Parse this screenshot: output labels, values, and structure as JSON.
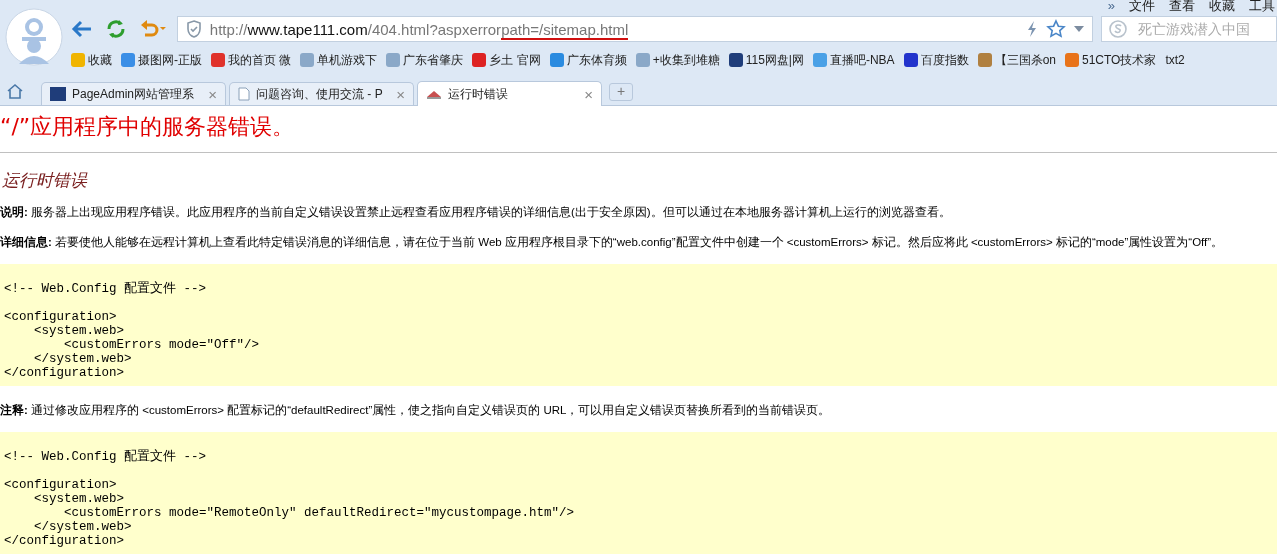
{
  "menu": {
    "chevron": "»",
    "items": [
      "文件",
      "查看",
      "收藏",
      "工具"
    ]
  },
  "address": {
    "segments": [
      {
        "text": "http://",
        "strong": false,
        "underlined": false
      },
      {
        "text": "www.tape111.com",
        "strong": true,
        "underlined": false
      },
      {
        "text": "/404.html?aspxerror",
        "strong": false,
        "underlined": false
      },
      {
        "text": "path=/sitemap.html",
        "strong": false,
        "underlined": true
      }
    ]
  },
  "search": {
    "placeholder": "死亡游戏潜入中国"
  },
  "bookmarks": [
    "收藏",
    "摄图网-正版",
    "我的首页 微",
    "单机游戏下",
    "广东省肇庆",
    "乡土 官网",
    "广东体育频",
    "+收集到堆糖",
    "115网盘|网",
    "直播吧-NBA",
    "百度指数",
    "【三国杀on",
    "51CTO技术家",
    "txt2"
  ],
  "tabs": [
    {
      "label": "PageAdmin网站管理系",
      "selected": false
    },
    {
      "label": "问题咨询、使用交流 - P",
      "selected": false
    },
    {
      "label": "运行时错误",
      "selected": true
    }
  ],
  "tab_close": "×",
  "new_tab": "+",
  "page": {
    "heading": "“/”应用程序中的服务器错误。",
    "subheading": "运行时错误",
    "blocks": [
      {
        "kind": "para",
        "text": "**说明:** 服务器上出现应用程序错误。此应用程序的当前自定义错误设置禁止远程查看应用程序错误的详细信息(出于安全原因)。但可以通过在本地服务器计算机上运行的浏览器查看。"
      },
      {
        "kind": "para",
        "text": "**详细信息:** 若要使他人能够在远程计算机上查看此特定错误消息的详细信息，请在位于当前 Web 应用程序根目录下的“web.config”配置文件中创建一个 <customErrors> 标记。然后应将此 <customErrors> 标记的“mode”属性设置为“Off”。"
      },
      {
        "kind": "code",
        "text": "<!-- Web.Config 配置文件 -->\n\n<configuration>\n    <system.web>\n        <customErrors mode=\"Off\"/>\n    </system.web>\n</configuration>"
      },
      {
        "kind": "para",
        "text": "**注释:** 通过修改应用程序的 <customErrors> 配置标记的“defaultRedirect”属性，使之指向自定义错误页的 URL，可以用自定义错误页替换所看到的当前错误页。"
      },
      {
        "kind": "code",
        "text": "<!-- Web.Config 配置文件 -->\n\n<configuration>\n    <system.web>\n        <customErrors mode=\"RemoteOnly\" defaultRedirect=\"mycustompage.htm\"/>\n    </system.web>\n</configuration>"
      }
    ]
  }
}
